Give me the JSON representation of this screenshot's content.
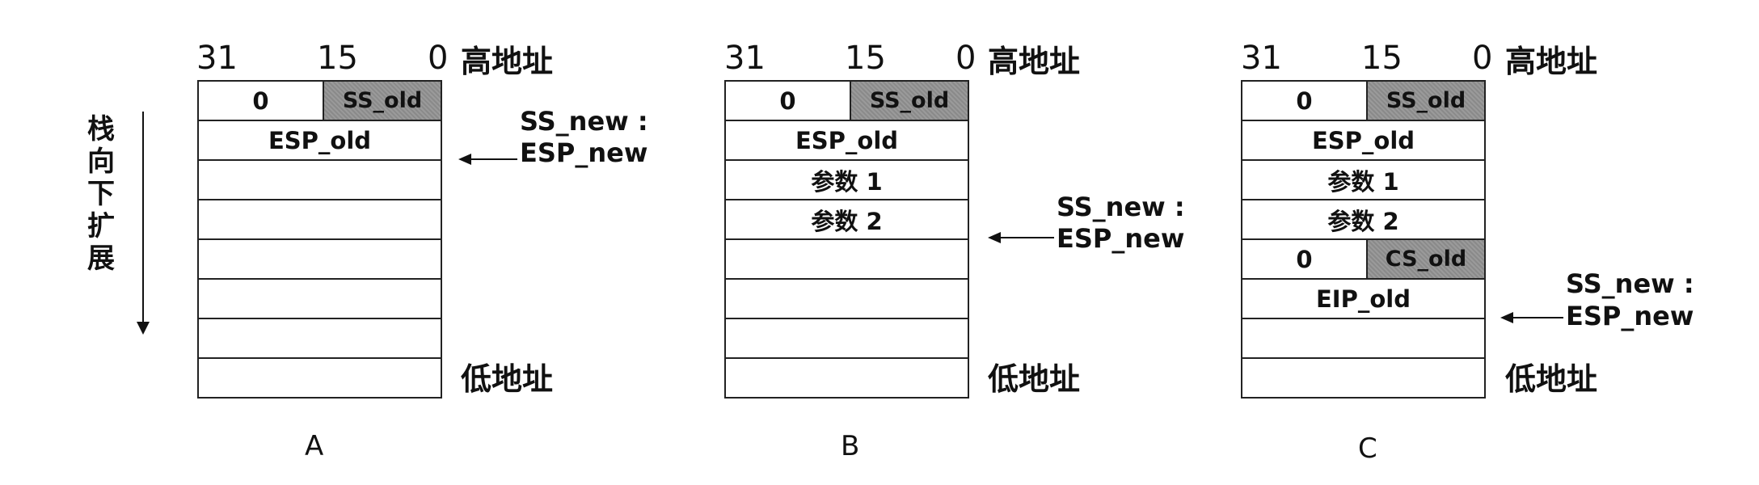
{
  "bit_labels": {
    "b31": "31",
    "b15": "15",
    "b0": "0"
  },
  "high_addr": "高地址",
  "low_addr": "低地址",
  "grow_direction": [
    "栈",
    "向",
    "下",
    "扩",
    "展"
  ],
  "ptr_ss": "SS_new :",
  "ptr_esp": "ESP_new",
  "panels": [
    {
      "id": "A",
      "caption": "A",
      "rows": [
        {
          "lo": "0",
          "hi": "SS_old"
        },
        {
          "full": "ESP_old"
        },
        {
          "full": ""
        },
        {
          "full": ""
        },
        {
          "full": ""
        },
        {
          "full": ""
        },
        {
          "full": ""
        },
        {
          "full": ""
        }
      ]
    },
    {
      "id": "B",
      "caption": "B",
      "rows": [
        {
          "lo": "0",
          "hi": "SS_old"
        },
        {
          "full": "ESP_old"
        },
        {
          "full": "参数 1"
        },
        {
          "full": "参数 2"
        },
        {
          "full": ""
        },
        {
          "full": ""
        },
        {
          "full": ""
        },
        {
          "full": ""
        }
      ]
    },
    {
      "id": "C",
      "caption": "C",
      "rows": [
        {
          "lo": "0",
          "hi": "SS_old"
        },
        {
          "full": "ESP_old"
        },
        {
          "full": "参数 1"
        },
        {
          "full": "参数 2"
        },
        {
          "lo": "0",
          "hi": "CS_old"
        },
        {
          "full": "EIP_old"
        },
        {
          "full": ""
        },
        {
          "full": ""
        }
      ]
    }
  ]
}
